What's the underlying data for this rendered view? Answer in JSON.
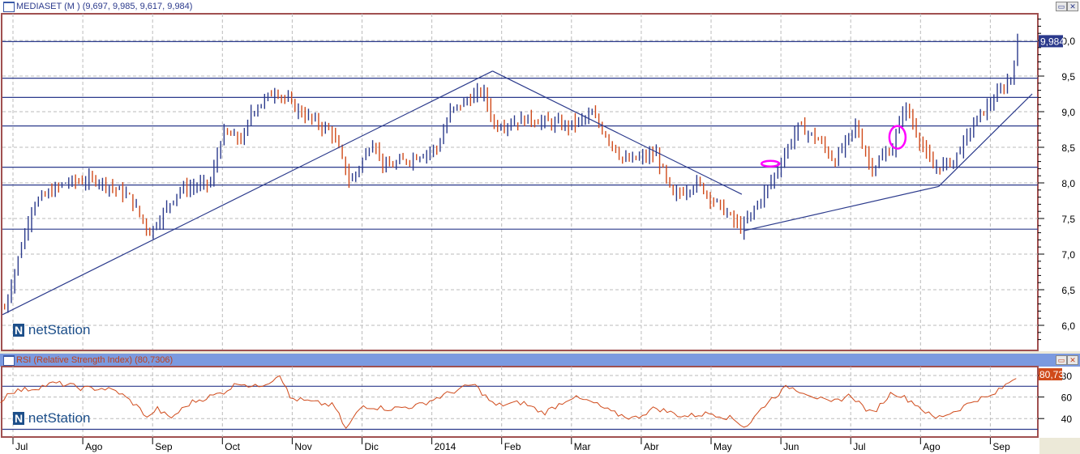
{
  "price_panel": {
    "title": "MEDIASET (M ) (9,697, 9,985, 9,617, 9,984)",
    "last_label": "9,984",
    "watermark": "netStation"
  },
  "rsi_panel": {
    "title": "RSI (Relative Strength Index) (80,7306)",
    "last_label": "80,73",
    "watermark": "netStation"
  },
  "colors": {
    "up": "#2b3a8c",
    "down": "#d04a1a",
    "rsi": "#d04a1a",
    "level": "#2b3a8c",
    "frame": "#a05050",
    "marker": "#ff00ff"
  },
  "chart_data": [
    {
      "type": "ohlc",
      "title": "MEDIASET (M )",
      "ylim": [
        5.7,
        10.4
      ],
      "yticks": [
        "6,0",
        "6,5",
        "7,0",
        "7,5",
        "8,0",
        "8,5",
        "9,0",
        "9,5",
        "10,0"
      ],
      "ytick_values": [
        6,
        6.5,
        7,
        7.5,
        8,
        8.5,
        9,
        9.5,
        10
      ],
      "xlabel_unit": "months since Jul 2013",
      "keypoints": [
        [
          -0.13,
          6.2
        ],
        [
          0.28,
          7.7
        ],
        [
          0.74,
          8.0
        ],
        [
          1.21,
          8.05
        ],
        [
          1.67,
          7.8
        ],
        [
          1.96,
          7.3
        ],
        [
          2.37,
          7.9
        ],
        [
          2.83,
          8.0
        ],
        [
          3.0,
          8.7
        ],
        [
          3.3,
          8.6
        ],
        [
          3.41,
          9.0
        ],
        [
          3.76,
          9.3
        ],
        [
          4.11,
          9.0
        ],
        [
          4.58,
          8.7
        ],
        [
          4.83,
          8.0
        ],
        [
          5.16,
          8.6
        ],
        [
          5.33,
          8.2
        ],
        [
          6.09,
          8.5
        ],
        [
          6.26,
          9.0
        ],
        [
          6.73,
          9.3
        ],
        [
          6.9,
          8.8
        ],
        [
          7.37,
          8.9
        ],
        [
          7.94,
          8.8
        ],
        [
          8.3,
          8.95
        ],
        [
          8.76,
          8.3
        ],
        [
          9.22,
          8.4
        ],
        [
          9.45,
          7.8
        ],
        [
          9.8,
          8.0
        ],
        [
          10.44,
          7.35
        ],
        [
          10.85,
          8.0
        ],
        [
          11.25,
          8.8
        ],
        [
          11.54,
          8.6
        ],
        [
          11.77,
          8.3
        ],
        [
          12.07,
          8.8
        ],
        [
          12.3,
          8.2
        ],
        [
          12.6,
          8.5
        ],
        [
          12.77,
          9.1
        ],
        [
          13.17,
          8.2
        ],
        [
          13.46,
          8.3
        ],
        [
          13.81,
          8.9
        ],
        [
          14.16,
          9.3
        ],
        [
          14.3,
          9.5
        ],
        [
          14.39,
          9.95
        ]
      ],
      "horizontal_levels": [
        9.984,
        9.47,
        9.2,
        8.8,
        8.22,
        7.97,
        7.35
      ],
      "trendlines": [
        [
          [
            -0.15,
            6.15
          ],
          [
            6.87,
            9.57
          ]
        ],
        [
          [
            6.87,
            9.57
          ],
          [
            10.44,
            7.84
          ]
        ],
        [
          [
            10.48,
            7.33
          ],
          [
            13.26,
            7.95
          ]
        ],
        [
          [
            13.26,
            7.95
          ],
          [
            14.6,
            9.25
          ]
        ]
      ],
      "markers": [
        [
          10.85,
          8.27,
          "small"
        ],
        [
          12.67,
          8.64,
          "tall"
        ]
      ],
      "last": 9.984
    },
    {
      "type": "line",
      "title": "RSI (Relative Strength Index)",
      "ylim": [
        23,
        88
      ],
      "yticks": [
        "40",
        "60",
        "80"
      ],
      "ytick_values": [
        40,
        60,
        80
      ],
      "levels": [
        70,
        30
      ],
      "keypoints": [
        [
          -0.18,
          55
        ],
        [
          -0.05,
          65
        ],
        [
          0.3,
          68
        ],
        [
          0.6,
          73
        ],
        [
          0.8,
          71
        ],
        [
          1.0,
          68
        ],
        [
          1.3,
          68
        ],
        [
          1.5,
          65
        ],
        [
          1.75,
          53
        ],
        [
          1.95,
          40
        ],
        [
          2.05,
          50
        ],
        [
          2.25,
          40
        ],
        [
          2.55,
          55
        ],
        [
          3.0,
          64
        ],
        [
          3.25,
          74
        ],
        [
          3.45,
          69
        ],
        [
          3.7,
          75
        ],
        [
          3.82,
          82
        ],
        [
          3.97,
          59
        ],
        [
          4.3,
          55
        ],
        [
          4.6,
          52
        ],
        [
          4.77,
          30
        ],
        [
          5.0,
          52
        ],
        [
          5.4,
          49
        ],
        [
          5.8,
          52
        ],
        [
          6.3,
          65
        ],
        [
          6.6,
          72
        ],
        [
          6.9,
          52
        ],
        [
          7.3,
          55
        ],
        [
          7.6,
          45
        ],
        [
          8.0,
          60
        ],
        [
          8.3,
          55
        ],
        [
          8.6,
          45
        ],
        [
          8.9,
          40
        ],
        [
          9.2,
          50
        ],
        [
          9.6,
          42
        ],
        [
          10.0,
          45
        ],
        [
          10.3,
          40
        ],
        [
          10.5,
          32
        ],
        [
          10.8,
          55
        ],
        [
          11.1,
          70
        ],
        [
          11.4,
          63
        ],
        [
          11.7,
          54
        ],
        [
          12.0,
          62
        ],
        [
          12.3,
          44
        ],
        [
          12.6,
          65
        ],
        [
          12.9,
          55
        ],
        [
          13.2,
          40
        ],
        [
          13.5,
          47
        ],
        [
          13.8,
          58
        ],
        [
          14.0,
          60
        ],
        [
          14.2,
          70
        ],
        [
          14.4,
          80.73
        ]
      ],
      "last": 80.73
    }
  ],
  "x_axis": {
    "labels": [
      "Jul",
      "Ago",
      "Sep",
      "Oct",
      "Nov",
      "Dic",
      "2014",
      "Feb",
      "Mar",
      "Abr",
      "May",
      "Jun",
      "Jul",
      "Ago",
      "Sep"
    ]
  }
}
